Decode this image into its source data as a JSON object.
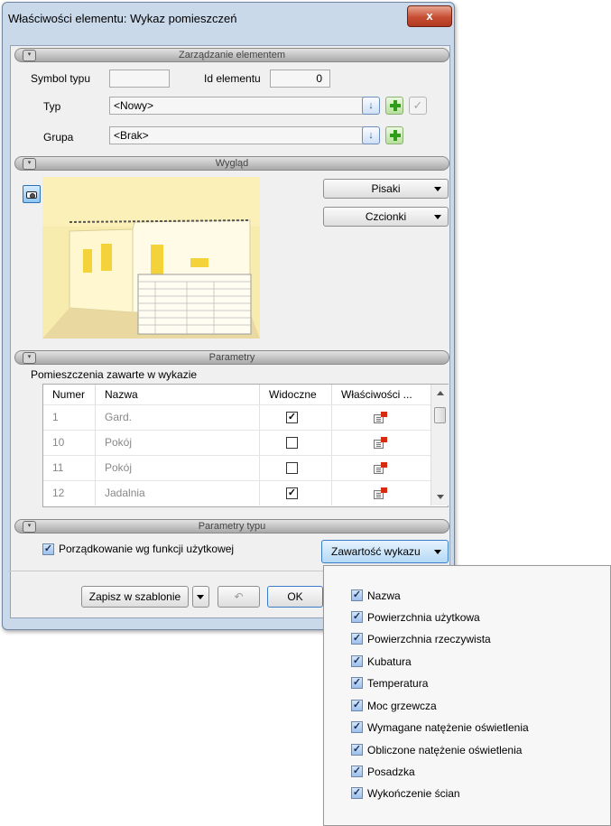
{
  "window": {
    "title": "Właściwości elementu: Wykaz pomieszczeń",
    "close_glyph": "x"
  },
  "sections": {
    "management": "Zarządzanie elementem",
    "appearance": "Wygląd",
    "parameters": "Parametry",
    "type_parameters": "Parametry typu"
  },
  "management": {
    "symbol_label": "Symbol typu",
    "symbol_value": "",
    "id_label": "Id elementu",
    "id_value": "0",
    "type_label": "Typ",
    "type_value": "<Nowy>",
    "group_label": "Grupa",
    "group_value": "<Brak>"
  },
  "appearance": {
    "pens_label": "Pisaki",
    "fonts_label": "Czcionki"
  },
  "parameters": {
    "list_title": "Pomieszczenia zawarte w wykazie",
    "columns": [
      "Numer",
      "Nazwa",
      "Widoczne",
      "Właściwości ..."
    ],
    "rows": [
      {
        "number": "1",
        "name": "Gard.",
        "visible": true
      },
      {
        "number": "10",
        "name": "Pokój",
        "visible": false
      },
      {
        "number": "11",
        "name": "Pokój",
        "visible": false
      },
      {
        "number": "12",
        "name": "Jadalnia",
        "visible": true
      }
    ]
  },
  "type_parameters": {
    "order_checkbox_label": "Porządkowanie wg funkcji użytkowej",
    "order_checked": true,
    "content_button_label": "Zawartość wykazu"
  },
  "footer": {
    "save_template_label": "Zapisz w szablonie",
    "ok_label": "OK"
  },
  "content_menu": {
    "items": [
      {
        "label": "Nazwa",
        "checked": true
      },
      {
        "label": "Powierzchnia użytkowa",
        "checked": true
      },
      {
        "label": "Powierzchnia rzeczywista",
        "checked": true
      },
      {
        "label": "Kubatura",
        "checked": true
      },
      {
        "label": "Temperatura",
        "checked": true
      },
      {
        "label": "Moc grzewcza",
        "checked": true
      },
      {
        "label": "Wymagane natężenie oświetlenia",
        "checked": true
      },
      {
        "label": "Obliczone natężenie oświetlenia",
        "checked": true
      },
      {
        "label": "Posadzka",
        "checked": true
      },
      {
        "label": "Wykończenie ścian",
        "checked": true
      }
    ]
  },
  "colors": {
    "accent": "#c9d9ea",
    "close_button": "#c64e33",
    "plus_green": "#2e9e1a",
    "preview_bg": "#fdf6c8"
  }
}
